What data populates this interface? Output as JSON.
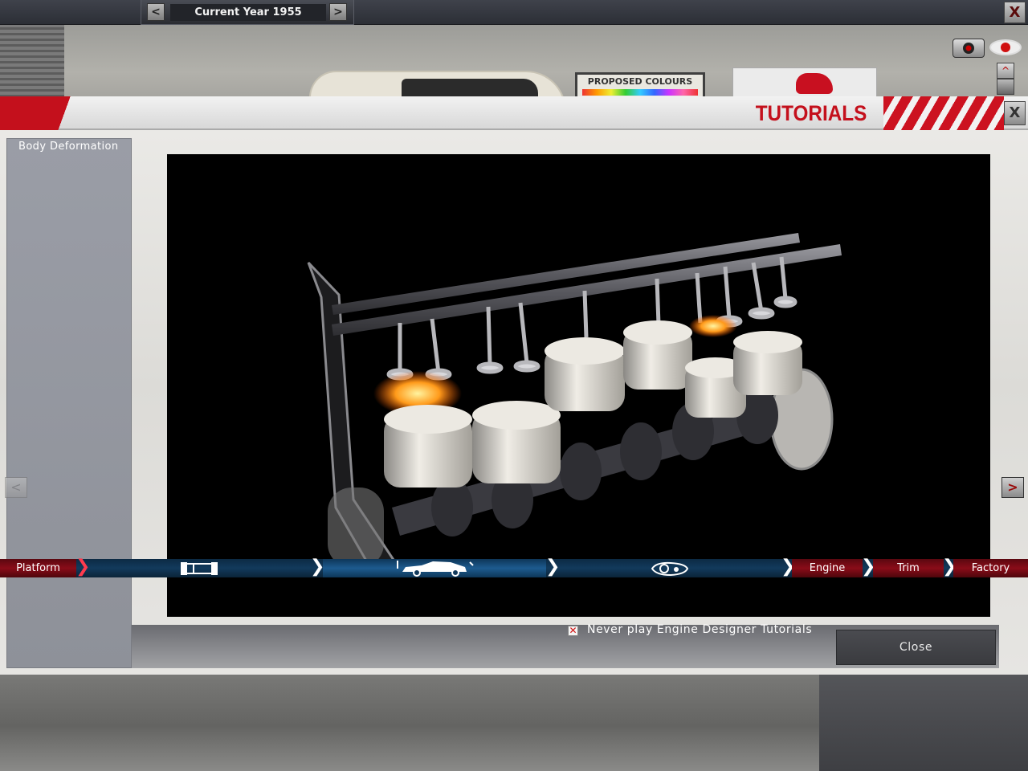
{
  "topbar": {
    "year_label": "Current Year 1955",
    "prev_icon": "<",
    "next_icon": ">",
    "close_icon": "X"
  },
  "scene": {
    "poster_text": "PROPOSED COLOURS"
  },
  "dialog": {
    "title": "TUTORIALS",
    "close_icon": "X",
    "tutorials": [
      "Body Deformation"
    ],
    "checkbox_mark": "✕",
    "checkbox_label": "Never play Engine Designer Tutorials",
    "close_label": "Close"
  },
  "side": {
    "left_arrow": "<",
    "right_arrow": ">"
  },
  "stages": {
    "platform": "Platform",
    "chassis_icon": "chassis-icon",
    "body_icon": "car-body-icon",
    "fixtures_icon": "headlight-icon",
    "engine": "Engine",
    "trim": "Trim",
    "factory": "Factory",
    "chevron": "❯"
  },
  "colors": {
    "accent_red": "#c4101c",
    "nav_blue": "#123a5c"
  }
}
